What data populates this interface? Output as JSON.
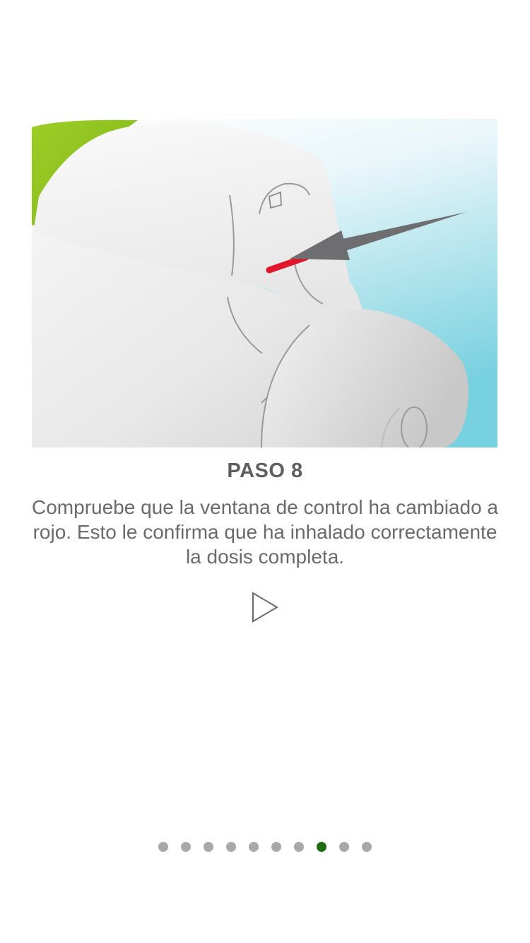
{
  "step": {
    "title": "PASO 8",
    "description": "Compruebe que la ventana de control ha cambiado a rojo. Esto le confirma que ha inhalado correctamente la dosis completa."
  },
  "illustration": {
    "subject": "inhaler-control-window",
    "colors": {
      "background_top": "#f6fbfd",
      "background_bottom": "#7fd3e0",
      "device_body": "#ececec",
      "device_green": "#8fc21f",
      "indicator_red": "#e0162b",
      "arrow": "#6e6e70"
    }
  },
  "controls": {
    "play_icon": "play-outline-icon"
  },
  "pager": {
    "total": 10,
    "active_index": 7,
    "active_color": "#1f6b12",
    "inactive_color": "#a8a8a8"
  }
}
